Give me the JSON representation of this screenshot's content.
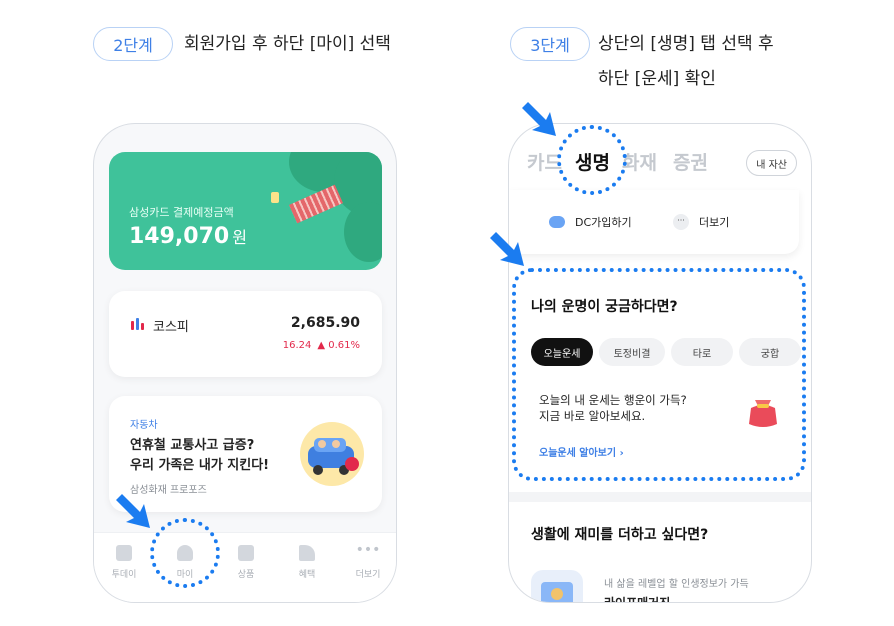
{
  "step2": {
    "badge": "2단계",
    "text": "회원가입 후 하단 [마이] 선택"
  },
  "step3": {
    "badge": "3단계",
    "line1": "상단의 [생명] 탭 선택 후",
    "line2": "하단 [운세] 확인"
  },
  "left_phone": {
    "payment": {
      "label": "삼성카드 결제예정금액",
      "amount": "149,070",
      "unit": "원"
    },
    "kospi": {
      "name": "코스피",
      "value": "2,685.90",
      "change": "16.24",
      "pct": "▲ 0.61%"
    },
    "news": {
      "category": "자동차",
      "title_line1": "연휴철 교통사고 급증?",
      "title_line2": "우리 가족은 내가 지킨다!",
      "source": "삼성화재 프로포즈"
    },
    "nav": [
      "투데이",
      "마이",
      "상품",
      "혜택",
      "더보기"
    ]
  },
  "right_phone": {
    "tabs": [
      "카드",
      "생명",
      "화재",
      "증권"
    ],
    "active_tab": "생명",
    "assets_button": "내 자산",
    "quick": {
      "dc": "DC가입하기",
      "more": "더보기"
    },
    "fortune": {
      "title": "나의 운명이 궁금하다면?",
      "chips": [
        "오늘운세",
        "토정비결",
        "타로",
        "궁합"
      ],
      "desc_line1": "오늘의 내 운세는 행운이 가득?",
      "desc_line2": "지금 바로 알아보세요.",
      "link": "오늘운세 알아보기 ›"
    },
    "life": {
      "title": "생활에 재미를 더하고 싶다면?",
      "desc": "내 삶을 레벨업 할 인생정보가 가득",
      "sub": "라이프매거진"
    }
  },
  "colors": {
    "accent": "#1b7cf0",
    "card_green": "#3fc29a",
    "negative": "#e2294b"
  }
}
